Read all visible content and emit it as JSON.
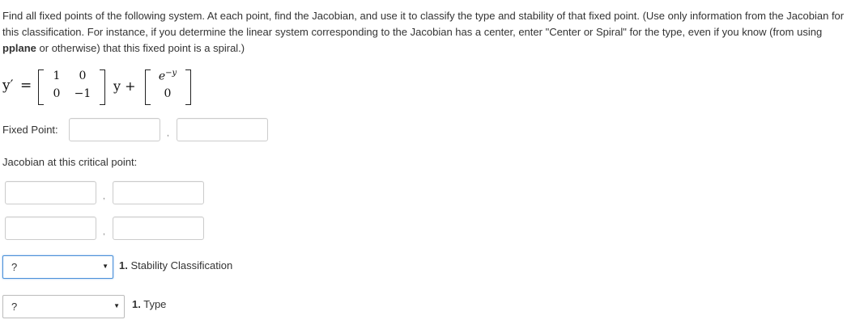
{
  "prompt": {
    "part1": "Find all fixed points of the following system. At each point, find the Jacobian, and use it to classify the type and stability of that fixed point. (Use only information from the Jacobian for this classification. For instance, if you determine the linear system corresponding to the Jacobian has a center, enter \"Center or Spiral\" for the type, even if you know (from using ",
    "bold": "pplane",
    "part2": " or otherwise) that this fixed point is a spiral.)"
  },
  "equation": {
    "lhs": "y′",
    "equals": "=",
    "matrix": [
      "1",
      "0",
      "0",
      "−1"
    ],
    "y_plus": "y +",
    "vec_top_base": "e",
    "vec_top_exp": "−y",
    "vec_bottom": "0"
  },
  "fixed_point": {
    "label": "Fixed Point:",
    "separator": ",",
    "values": [
      "",
      ""
    ]
  },
  "jacobian": {
    "label": "Jacobian at this critical point:",
    "separator": ",",
    "values": [
      "",
      "",
      "",
      ""
    ]
  },
  "stability": {
    "selected": "?",
    "label_num": "1.",
    "label": " Stability Classification"
  },
  "type": {
    "selected": "?",
    "label_num": "1.",
    "label": " Type"
  }
}
